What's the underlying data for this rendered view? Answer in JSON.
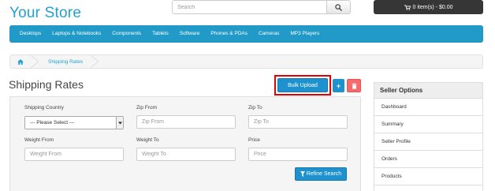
{
  "header": {
    "store_name": "Your Store",
    "search_placeholder": "Search",
    "cart_label": "0 item(s) - $0.00"
  },
  "menu": [
    "Desktops",
    "Laptops & Notebooks",
    "Components",
    "Tablets",
    "Software",
    "Phones & PDAs",
    "Cameras",
    "MP3 Players"
  ],
  "breadcrumb": {
    "current": "Shipping Rates"
  },
  "page": {
    "title": "Shipping Rates",
    "bulk_upload_label": "Bulk Upload",
    "add_label": "+"
  },
  "filter": {
    "shipping_country_label": "Shipping Country",
    "shipping_country_value": "--- Please Select ---",
    "zip_from_label": "Zip From",
    "zip_from_placeholder": "Zip From",
    "zip_to_label": "Zip To",
    "zip_to_placeholder": "Zip To",
    "weight_from_label": "Weight From",
    "weight_from_placeholder": "Weight From",
    "weight_to_label": "Weight To",
    "weight_to_placeholder": "Weight To",
    "price_label": "Price",
    "price_placeholder": "Price",
    "refine_label": "Refine Search"
  },
  "seller_options": {
    "title": "Seller Options",
    "items": [
      "Dashboard",
      "Summary",
      "Seller Profile",
      "Orders",
      "Products"
    ]
  },
  "colors": {
    "brand": "#23a1d1",
    "menu_bg": "#229ac8",
    "primary_button": "#1e91cf",
    "danger_button": "#f56b6b",
    "highlight_outline": "#e00000"
  },
  "icons": {
    "search": "search-icon",
    "cart": "cart-icon",
    "home": "home-icon",
    "delete": "trash-icon",
    "filter": "filter-icon",
    "dropdown": "chevron-down-icon"
  }
}
